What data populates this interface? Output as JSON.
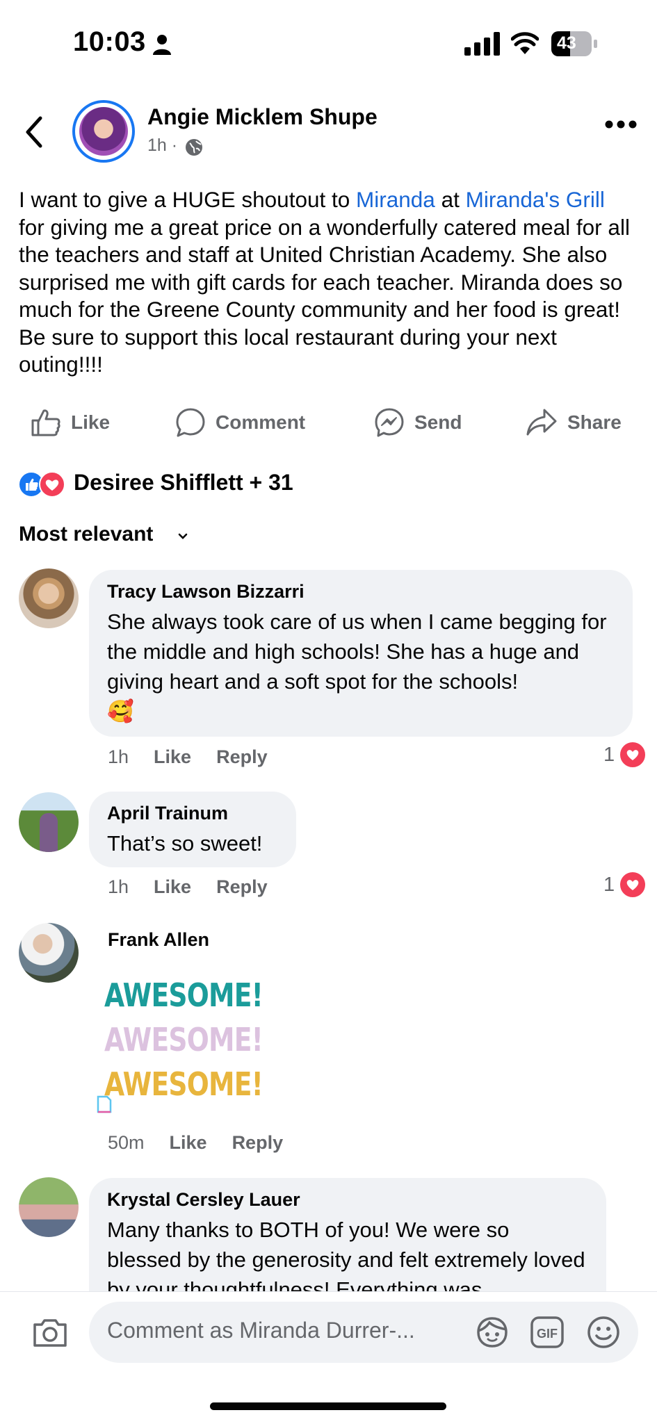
{
  "status_bar": {
    "time": "10:03",
    "battery": "43"
  },
  "post": {
    "author": "Angie Micklem Shupe",
    "time": "1h",
    "meta_sep": "·",
    "text_1": "I want to give a HUGE shoutout to ",
    "link_1": "Miranda",
    "text_2": " at ",
    "link_2": "Miranda's Grill",
    "text_3": " for giving me a great price on a wonderfully catered meal for all the teachers and staff at United Christian Academy. She also surprised me with gift cards for each teacher. Miranda does so much for the Greene County community and her food is great! Be sure to support this local restaurant during your next outing!!!!"
  },
  "actions": {
    "like": "Like",
    "comment": "Comment",
    "send": "Send",
    "share": "Share"
  },
  "reactions": {
    "summary": "Desiree Shifflett + 31"
  },
  "sort": {
    "label": "Most relevant"
  },
  "comments": [
    {
      "name": "Tracy Lawson Bizzarri",
      "text": "She always took care of us when I came begging for the middle and high schools! She has a huge and giving heart and a soft spot for the schools!",
      "emoji": "🥰",
      "time": "1h",
      "like": "Like",
      "reply": "Reply",
      "reactions": "1"
    },
    {
      "name": "April Trainum",
      "text": "That’s so sweet!",
      "time": "1h",
      "like": "Like",
      "reply": "Reply",
      "reactions": "1"
    },
    {
      "name": "Frank Allen",
      "sticker": [
        "AWESOME!",
        "AWESOME!",
        "AWESOME!"
      ],
      "time": "50m",
      "like": "Like",
      "reply": "Reply"
    },
    {
      "name": "Krystal Cersley Lauer",
      "text": "Many thanks to BOTH of you! We were so blessed by the generosity and felt extremely loved by your thoughtfulness!  Everything was"
    }
  ],
  "composer": {
    "placeholder": "Comment as Miranda Durrer-..."
  },
  "colors": {
    "accent": "#1877f2",
    "link": "#1866d6",
    "love": "#f33e58",
    "bubble": "#f0f2f5",
    "sticker": [
      "#1b9c9a",
      "#dcc2df",
      "#e8b53d"
    ]
  }
}
